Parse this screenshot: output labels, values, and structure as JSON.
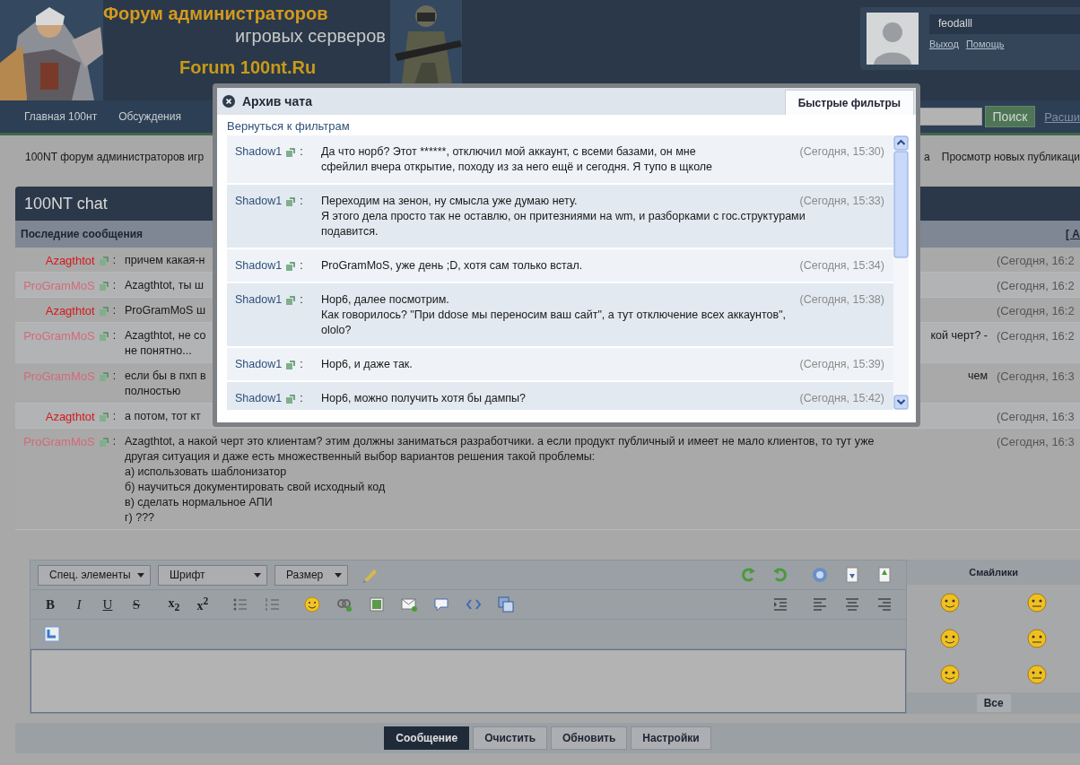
{
  "header": {
    "logo_lines": [
      "Форум администраторов",
      "игровых серверов",
      "Forum 100nt.Ru"
    ],
    "user": {
      "name": "feodalll",
      "links": [
        "Выход",
        "Помощь"
      ]
    }
  },
  "nav": {
    "items": [
      "Главная 100нт",
      "Обсуждения"
    ],
    "search_button": "Поиск",
    "extra_link": "Расши"
  },
  "breadcrumb": {
    "left": "100NT форум администраторов игр",
    "right": [
      "а",
      "Просмотр новых публикаци"
    ]
  },
  "chat": {
    "title": "100NT chat",
    "subheader": "Последние сообщения",
    "subheader_link": "[ А",
    "messages": [
      {
        "user": "Azagthtot",
        "color": "#d21a1a",
        "separator": ":",
        "left": [
          "причем какая-н"
        ],
        "time": "(Сегодня, 16:2"
      },
      {
        "user": "ProGramMoS",
        "color": "#d46a78",
        "separator": ":",
        "left": [
          "Azagthtot, ты ш"
        ],
        "time": "(Сегодня, 16:2"
      },
      {
        "user": "Azagthtot",
        "color": "#d21a1a",
        "separator": ":",
        "left": [
          "ProGramMoS ш"
        ],
        "time": "(Сегодня, 16:2"
      },
      {
        "user": "ProGramMoS",
        "color": "#d46a78",
        "separator": ":",
        "left": [
          "Azagthtot, не со",
          "не понятно..."
        ],
        "right": [
          "кой черт? -"
        ],
        "time": "(Сегодня, 16:2"
      },
      {
        "user": "ProGramMoS",
        "color": "#d46a78",
        "separator": ":",
        "left": [
          "если бы в пхп в",
          "полностью"
        ],
        "right": [
          "чем"
        ],
        "time": "(Сегодня, 16:3"
      },
      {
        "user": "Azagthtot",
        "color": "#d21a1a",
        "separator": ":",
        "left": [
          "а потом, тот кт"
        ],
        "time": "(Сегодня, 16:3"
      },
      {
        "user": "ProGramMoS",
        "color": "#d46a78",
        "separator": ":",
        "left": [
          "Azagthtot, а накой черт это клиентам? этим должны заниматься разработчики. а если продукт публичный и имеет не мало клиентов, то тут уже",
          "другая ситуация и даже есть множественный выбор вариантов решения такой проблемы:",
          "а) использовать шаблонизатор",
          "б) научиться документировать свой исходный код",
          "в) сделать нормальное АПИ",
          "г) ???"
        ],
        "time": "(Сегодня, 16:3"
      }
    ]
  },
  "editor": {
    "selects": [
      "Спец. элементы",
      "Шрифт",
      "Размер"
    ],
    "format_buttons": [
      "B",
      "I",
      "U",
      "S",
      "x$_{2}$",
      "x$^{2}$"
    ],
    "smilies_title": "Смайлики",
    "smilies_all": "Все",
    "buttons": [
      {
        "label": "Сообщение",
        "selected": true
      },
      {
        "label": "Очистить",
        "selected": false
      },
      {
        "label": "Обновить",
        "selected": false
      },
      {
        "label": "Настройки",
        "selected": false
      }
    ]
  },
  "modal": {
    "title": "Архив чата",
    "tabs": [
      {
        "label": "Быстрые фильтры",
        "selected": true
      }
    ],
    "back_link": "Вернуться к фильтрам",
    "messages": [
      {
        "user": "Shadow1",
        "separator": ":",
        "lines": [
          "Да что норб? Этот ******, отключил мой аккаунт, с всеми базами, он мне",
          "сфейлил вчера открытие, походу из за него ещё и сегодня. Я тупо в щколе"
        ],
        "time": "(Сегодня, 15:30)"
      },
      {
        "user": "Shadow1",
        "separator": ":",
        "lines": [
          "Переходим на зенон, ну смысла уже думаю нету.",
          "Я этого дела просто так не оставлю, он притезниями на wm, и разборками с гос.структурами",
          "подавится."
        ],
        "time": "(Сегодня, 15:33)"
      },
      {
        "user": "Shadow1",
        "separator": ":",
        "lines": [
          "ProGramMoS, уже день ;D, хотя сам только встал."
        ],
        "time": "(Сегодня, 15:34)"
      },
      {
        "user": "Shadow1",
        "separator": ":",
        "lines": [
          "Нор6, далее посмотрим.",
          "Как говорилось? \"При ddose мы переносим ваш сайт\", а тут отключение всех аккаунтов\",",
          "ololo?"
        ],
        "time": "(Сегодня, 15:38)"
      },
      {
        "user": "Shadow1",
        "separator": ":",
        "lines": [
          "Нор6, и даже так."
        ],
        "time": "(Сегодня, 15:39)"
      },
      {
        "user": "Shadow1",
        "separator": ":",
        "lines": [
          "Нор6, можно получить хотя бы дампы?"
        ],
        "time": "(Сегодня, 15:42)"
      }
    ]
  }
}
